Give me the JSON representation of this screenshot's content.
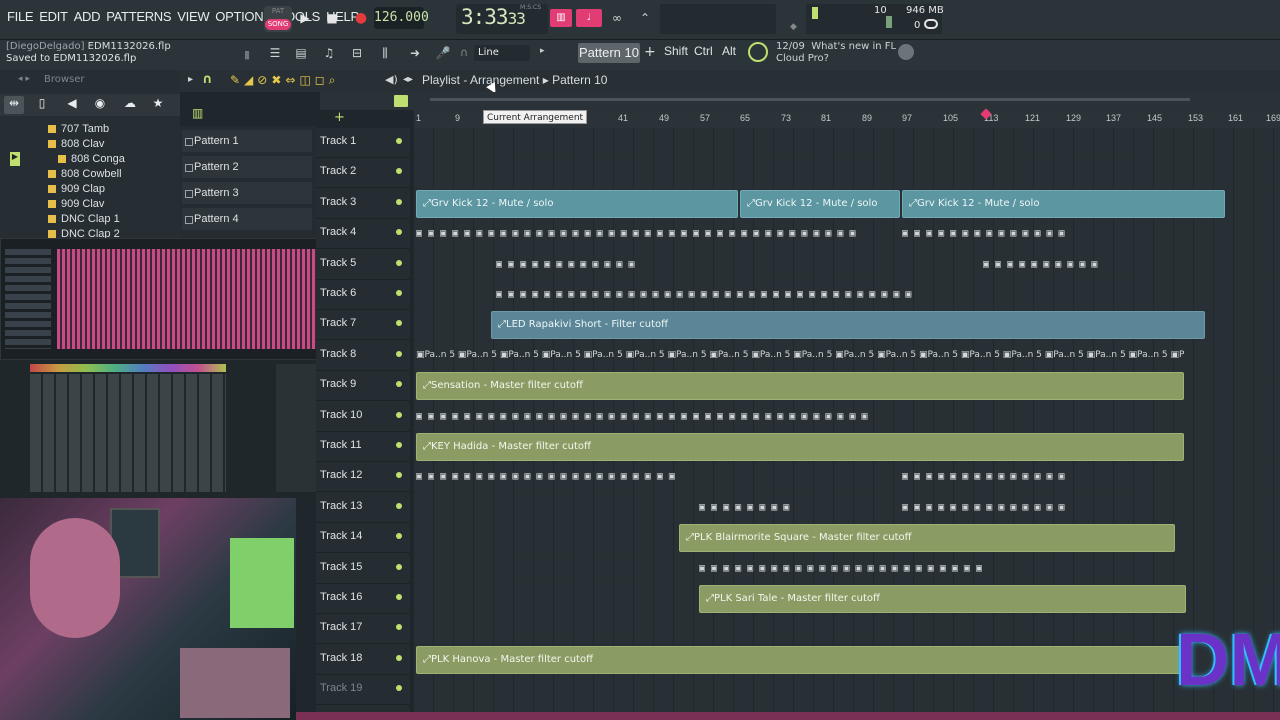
{
  "menu": [
    "FILE",
    "EDIT",
    "ADD",
    "PATTERNS",
    "VIEW",
    "OPTIONS",
    "TOOLS",
    "HELP"
  ],
  "transport": {
    "pat_label": "PAT",
    "song_label": "SONG",
    "tempo": "126.000",
    "time": "3:33",
    "time_small": "33",
    "msc": "M:S:CS"
  },
  "status": {
    "poly": "10",
    "mem": "946 MB",
    "poly2": "0"
  },
  "file": {
    "user": "[DiegoDelgado]",
    "name": "EDM1132026.flp",
    "saved": "Saved to EDM1132026.flp"
  },
  "toolbar": {
    "snap": "Line",
    "pattern": "Pattern 10",
    "shift": "Shift",
    "ctrl": "Ctrl",
    "alt": "Alt",
    "news_date": "12/09",
    "news_line1": "What's new in FL",
    "news_line2": "Cloud Pro?"
  },
  "browser": {
    "title": "Browser",
    "items": [
      "707 Tamb",
      "808 Clav",
      "808 Conga",
      "808 Cowbell",
      "909 Clap",
      "909 Clav",
      "DNC Clap 1",
      "DNC Clap 2"
    ]
  },
  "patterns": [
    "Pattern 1",
    "Pattern 2",
    "Pattern 3",
    "Pattern 4"
  ],
  "playlist": {
    "title": "Playlist - Arrangement",
    "title_sep": "▸",
    "title_pattern": "Pattern 10",
    "tooltip": "Current Arrangement",
    "ruler": [
      "1",
      "9",
      "33",
      "41",
      "49",
      "57",
      "65",
      "73",
      "81",
      "89",
      "97",
      "105",
      "113",
      "121",
      "129",
      "137",
      "145",
      "153",
      "161",
      "169"
    ],
    "tracks": [
      "Track 1",
      "Track 2",
      "Track 3",
      "Track 4",
      "Track 5",
      "Track 6",
      "Track 7",
      "Track 8",
      "Track 9",
      "Track 10",
      "Track 11",
      "Track 12",
      "Track 13",
      "Track 14",
      "Track 15",
      "Track 16",
      "Track 17",
      "Track 18",
      "Track 19"
    ],
    "clips": {
      "kick": "Grv Kick 12 - Mute / solo",
      "led": "LED Rapakivi Short - Filter cutoff",
      "sensation": "Sensation - Master filter cutoff",
      "key": "KEY Hadida - Master filter cutoff",
      "blair": "PLK Blairmorite Square - Master filter cutoff",
      "sari": "PLK Sari Tale - Master filter cutoff",
      "hanova": "PLK Hanova - Master filter cutoff",
      "pat_short": "Pa..n 5"
    }
  },
  "colors": {
    "accent": "#e23c74",
    "auto_clip": "#8a9c63",
    "kick_clip": "#5c96a0",
    "lcd": "#d6e8bd"
  },
  "logo": "DM"
}
